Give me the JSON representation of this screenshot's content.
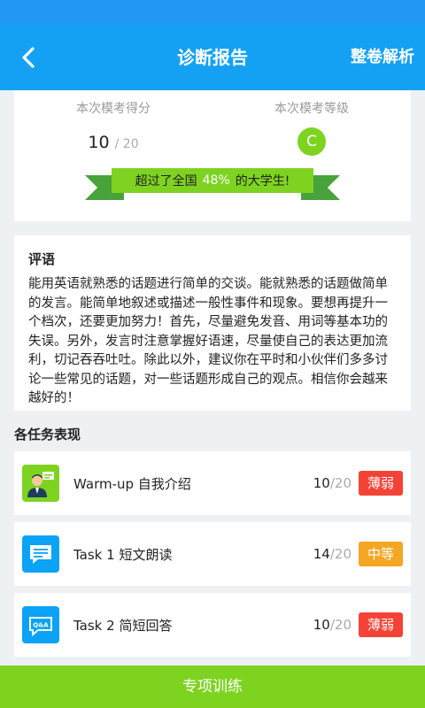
{
  "header": {
    "title": "诊断报告",
    "action_label": "整卷解析",
    "back_icon": "chevron-left-icon"
  },
  "summary": {
    "score_label": "本次模考得分",
    "score": "10",
    "score_total": "/ 20",
    "grade_label": "本次模考等级",
    "grade": "C",
    "grade_color": "#7ed321",
    "ribbon_prefix": "超过了全国",
    "ribbon_percent": "48%",
    "ribbon_suffix": "的大学生!"
  },
  "comment": {
    "title": "评语",
    "text": "能用英语就熟悉的话题进行简单的交谈。能就熟悉的话题做简单的发言。能简单地叙述或描述一般性事件和现象。要想再提升一个档次，还要更加努力！首先，尽量避免发音、用词等基本功的失误。另外，发言时注意掌握好语速，尽量使自己的表达更加流利，切记吞吞吐吐。除此以外，建议你在平时和小伙伴们多多讨论一些常见的话题，对一些话题形成自己的观点。相信你会越来越好的！"
  },
  "tasks_section": {
    "title": "各任务表现",
    "items": [
      {
        "name": "Warm-up 自我介绍",
        "score": "10",
        "total": "/20",
        "level": "薄弱",
        "level_color": "#f44336",
        "icon": "presenter-icon",
        "icon_color": "#7ed321"
      },
      {
        "name": "Task 1 短文朗读",
        "score": "14",
        "total": "/20",
        "level": "中等",
        "level_color": "#f5a623",
        "icon": "chat-bubble-icon",
        "icon_color": "#0aa3f5"
      },
      {
        "name": "Task 2 简短回答",
        "score": "10",
        "total": "/20",
        "level": "薄弱",
        "level_color": "#f44336",
        "icon": "qa-bubble-icon",
        "icon_color": "#0aa3f5"
      }
    ]
  },
  "footer": {
    "button_label": "专项训练"
  },
  "colors": {
    "primary": "#15a1f3",
    "accent": "#7ed321",
    "weak": "#f44336",
    "medium": "#f5a623"
  }
}
